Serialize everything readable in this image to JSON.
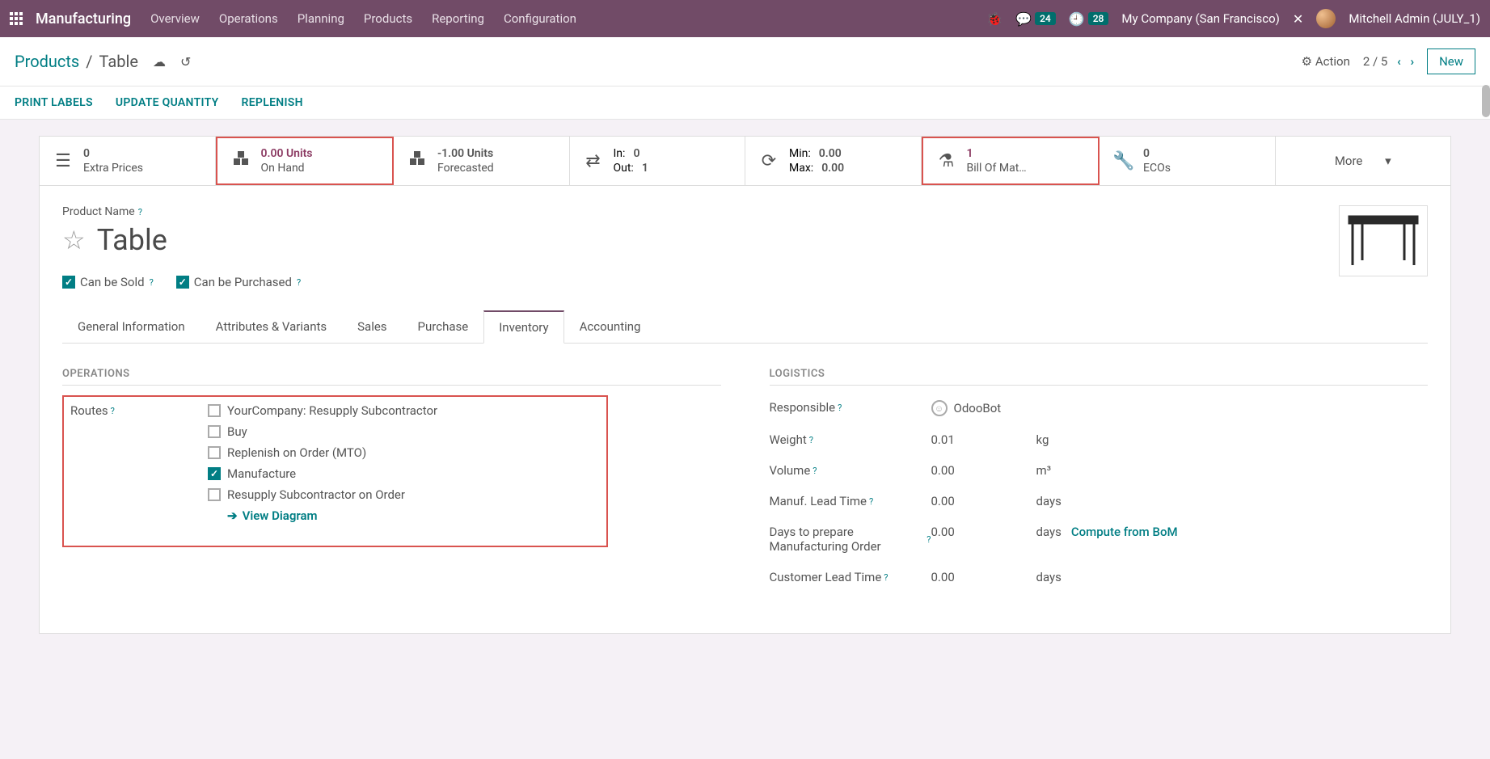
{
  "topbar": {
    "app_name": "Manufacturing",
    "nav": [
      "Overview",
      "Operations",
      "Planning",
      "Products",
      "Reporting",
      "Configuration"
    ],
    "messages_badge": "24",
    "activities_badge": "28",
    "company": "My Company (San Francisco)",
    "user": "Mitchell Admin (JULY_1)"
  },
  "breadcrumb": {
    "parent": "Products",
    "current": "Table",
    "action_label": "Action",
    "pager": "2 / 5",
    "new_label": "New"
  },
  "action_buttons": [
    "PRINT LABELS",
    "UPDATE QUANTITY",
    "REPLENISH"
  ],
  "statbar": {
    "extra_prices": {
      "line1": "0",
      "line2": "Extra Prices"
    },
    "on_hand": {
      "line1": "0.00 Units",
      "line2": "On Hand"
    },
    "forecasted": {
      "line1": "-1.00 Units",
      "line2": "Forecasted"
    },
    "inout": {
      "in_label": "In:",
      "in_val": "0",
      "out_label": "Out:",
      "out_val": "1"
    },
    "minmax": {
      "min_label": "Min:",
      "min_val": "0.00",
      "max_label": "Max:",
      "max_val": "0.00"
    },
    "bom": {
      "line1": "1",
      "line2": "Bill Of Mat…"
    },
    "ecos": {
      "line1": "0",
      "line2": "ECOs"
    },
    "more_label": "More"
  },
  "form": {
    "product_name_label": "Product Name",
    "name": "Table",
    "can_be_sold": "Can be Sold",
    "can_be_purchased": "Can be Purchased"
  },
  "tabs": [
    "General Information",
    "Attributes & Variants",
    "Sales",
    "Purchase",
    "Inventory",
    "Accounting"
  ],
  "active_tab": "Inventory",
  "operations": {
    "title": "OPERATIONS",
    "routes_label": "Routes",
    "routes": [
      {
        "label": "YourCompany: Resupply Subcontractor",
        "checked": false
      },
      {
        "label": "Buy",
        "checked": false
      },
      {
        "label": "Replenish on Order (MTO)",
        "checked": false
      },
      {
        "label": "Manufacture",
        "checked": true
      },
      {
        "label": "Resupply Subcontractor on Order",
        "checked": false
      }
    ],
    "view_diagram": "View Diagram"
  },
  "logistics": {
    "title": "LOGISTICS",
    "responsible_label": "Responsible",
    "responsible_value": "OdooBot",
    "weight_label": "Weight",
    "weight_value": "0.01",
    "weight_unit": "kg",
    "volume_label": "Volume",
    "volume_value": "0.00",
    "volume_unit": "m³",
    "manuf_lead_label": "Manuf. Lead Time",
    "manuf_lead_value": "0.00",
    "manuf_lead_unit": "days",
    "days_prepare_label": "Days to prepare Manufacturing Order",
    "days_prepare_value": "0.00",
    "days_prepare_unit": "days",
    "compute_bom": "Compute from BoM",
    "customer_lead_label": "Customer Lead Time",
    "customer_lead_value": "0.00",
    "customer_lead_unit": "days"
  }
}
